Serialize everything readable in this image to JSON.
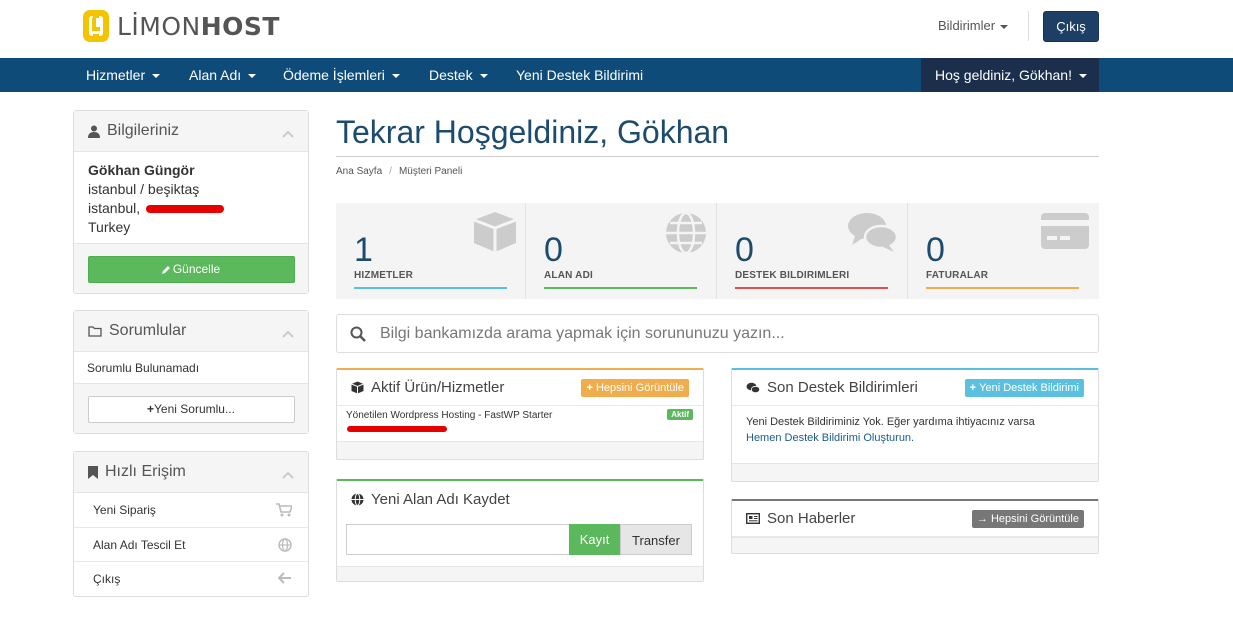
{
  "brand": {
    "name_light": "LİMON",
    "name_bold": "HOST",
    "colors": {
      "accent": "#f5c400",
      "dark": "#555555"
    }
  },
  "header": {
    "notifications_label": "Bildirimler",
    "logout_label": "Çıkış"
  },
  "nav": {
    "items": [
      {
        "label": "Hizmetler",
        "dropdown": true
      },
      {
        "label": "Alan Adı",
        "dropdown": true
      },
      {
        "label": "Ödeme İşlemleri",
        "dropdown": true
      },
      {
        "label": "Destek",
        "dropdown": true
      },
      {
        "label": "Yeni Destek Bildirimi",
        "dropdown": false
      }
    ],
    "welcome": "Hoş geldiniz, Gökhan!"
  },
  "sidebar": {
    "info": {
      "title": "Bilgileriniz",
      "name": "Gökhan Güngör",
      "line1": "istanbul / beşiktaş",
      "line2": "istanbul,",
      "country": "Turkey",
      "update_label": "Güncelle"
    },
    "contacts": {
      "title": "Sorumlular",
      "empty_text": "Sorumlu Bulunamadı",
      "new_label": "Yeni Sorumlu..."
    },
    "quick": {
      "title": "Hızlı Erişim",
      "items": [
        {
          "label": "Yeni Sipariş",
          "icon": "cart-icon"
        },
        {
          "label": "Alan Adı Tescil Et",
          "icon": "globe-icon"
        },
        {
          "label": "Çıkış",
          "icon": "arrow-left-icon"
        }
      ]
    }
  },
  "main": {
    "title": "Tekrar Hoşgeldiniz, Gökhan",
    "breadcrumb": [
      "Ana Sayfa",
      "Müşteri Paneli"
    ],
    "stats": [
      {
        "value": "1",
        "label": "HIZMETLER",
        "color": "#5bc0de",
        "icon": "cube-icon"
      },
      {
        "value": "0",
        "label": "ALAN ADI",
        "color": "#5cb85c",
        "icon": "globe-icon"
      },
      {
        "value": "0",
        "label": "DESTEK BILDIRIMLERI",
        "color": "#d9534f",
        "icon": "comments-icon"
      },
      {
        "value": "0",
        "label": "FATURALAR",
        "color": "#f0ad4e",
        "icon": "credit-card-icon"
      }
    ],
    "search_placeholder": "Bilgi bankamızda arama yapmak için sorununuzu yazın...",
    "services": {
      "title": "Aktif Ürün/Hizmetler",
      "view_all_label": "Hepsini Görüntüle",
      "item_name": "Yönetilen Wordpress Hosting - FastWP Starter",
      "item_status": "Aktif"
    },
    "domain": {
      "title": "Yeni Alan Adı Kaydet",
      "register_label": "Kayıt",
      "transfer_label": "Transfer",
      "input_value": ""
    },
    "tickets": {
      "title": "Son Destek Bildirimleri",
      "new_label": "Yeni Destek Bildirimi",
      "empty_text": "Yeni Destek Bildiriminiz Yok. Eğer yardıma ihtiyacınız varsa",
      "create_link": "Hemen Destek Bildirimi Oluşturun."
    },
    "news": {
      "title": "Son Haberler",
      "view_all_label": "Hepsini Görüntüle"
    }
  }
}
